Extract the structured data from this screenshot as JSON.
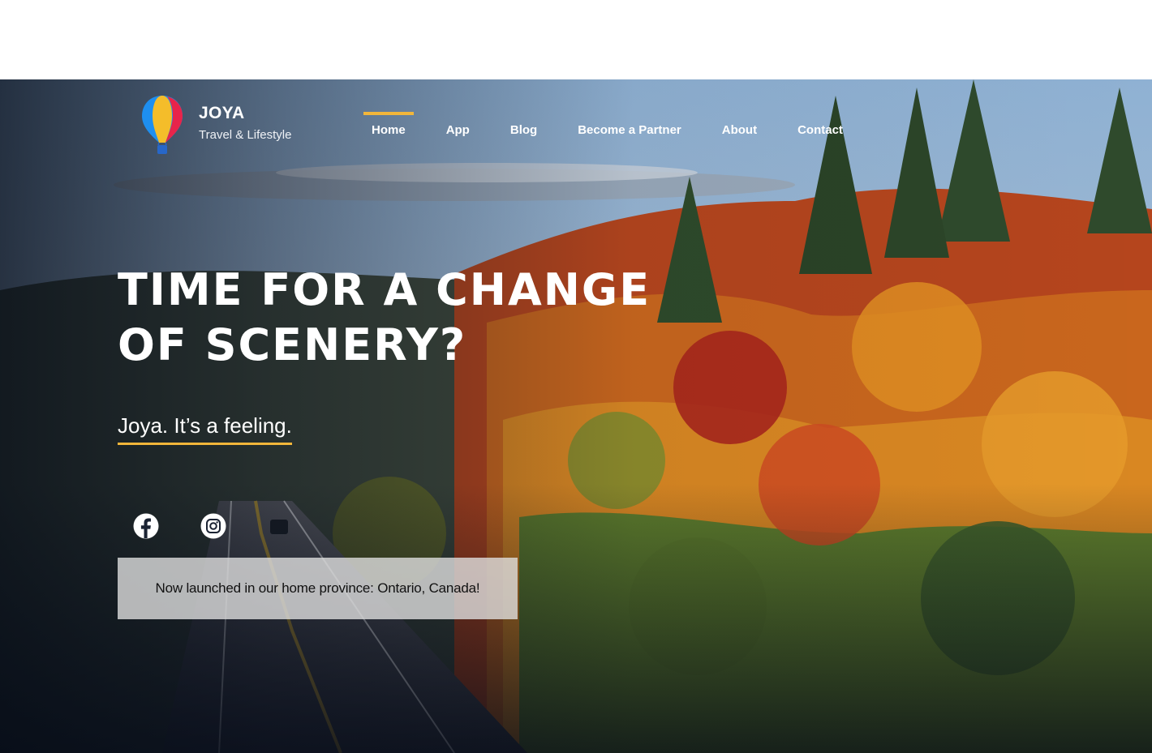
{
  "brand": {
    "name": "JOYA",
    "tagline": "Travel & Lifestyle"
  },
  "nav": {
    "items": [
      {
        "label": "Home",
        "active": true
      },
      {
        "label": "App",
        "active": false
      },
      {
        "label": "Blog",
        "active": false
      },
      {
        "label": "Become a Partner",
        "active": false
      },
      {
        "label": "About",
        "active": false
      },
      {
        "label": "Contact",
        "active": false
      }
    ]
  },
  "hero": {
    "headline": "TIME FOR A CHANGE OF SCENERY?",
    "tagline": "Joya. It’s a feeling.",
    "social_icons": [
      "facebook-icon",
      "instagram-icon"
    ],
    "notice": "Now launched in our home province: Ontario, Canada!"
  },
  "colors": {
    "accent": "#f2b63a",
    "notice_bg": "#dedede"
  }
}
